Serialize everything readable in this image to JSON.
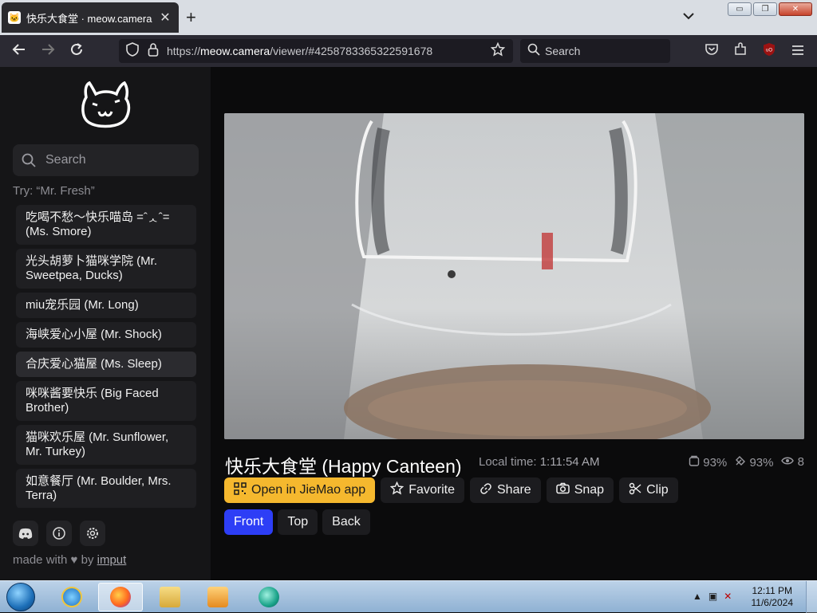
{
  "browser": {
    "tab_title": "快乐大食堂 · meow.camera",
    "tab_close": "✕",
    "new_tab": "+",
    "tab_list": "⌄",
    "url_prefix": "https://",
    "url_host": "meow.camera",
    "url_path": "/viewer/#4258783365322591678",
    "search_placeholder": "Search",
    "window_buttons": {
      "minimize": "▭",
      "restore": "❐",
      "close": "✕"
    }
  },
  "sidebar": {
    "search_placeholder": "Search",
    "hint": "Try: “Mr. Fresh”",
    "cameras": [
      {
        "label": "吃喝不愁～快乐喵岛 =ˆᆺˆ= (Ms. Smore)"
      },
      {
        "label": "光头胡萝卜猫咪学院 (Mr. Sweetpea, Ducks)"
      },
      {
        "label": "miu宠乐园 (Mr. Long)"
      },
      {
        "label": "海峡爱心小屋 (Mr. Shock)"
      },
      {
        "label": "合庆爱心猫屋 (Ms. Sleep)"
      },
      {
        "label": "咪咪酱要快乐 (Big Faced Brother)"
      },
      {
        "label": "猫咪欢乐屋 (Mr. Sunflower, Mr. Turkey)"
      },
      {
        "label": "如意餐厅 (Mr. Boulder, Mrs. Terra)"
      }
    ],
    "made_with_prefix": "made with",
    "made_with_by": "by",
    "made_with_author": "imput"
  },
  "viewer": {
    "title": "快乐大食堂 (Happy Canteen)",
    "local_time_label": "Local time:",
    "local_time": "1:11:54 AM",
    "stats": {
      "food": "93%",
      "battery": "93%",
      "viewers": "8"
    },
    "actions": {
      "open_app": "Open in JieMao app",
      "favorite": "Favorite",
      "share": "Share",
      "snap": "Snap",
      "clip": "Clip"
    },
    "views": [
      "Front",
      "Top",
      "Back"
    ],
    "active_view": "Front"
  },
  "taskbar": {
    "time": "12:11 PM",
    "date": "11/6/2024"
  },
  "colors": {
    "accent_yellow": "#f5b82e",
    "active_view_blue": "#2d3ef6",
    "sidebar_bg": "#151517",
    "page_bg": "#0b0b0c"
  }
}
